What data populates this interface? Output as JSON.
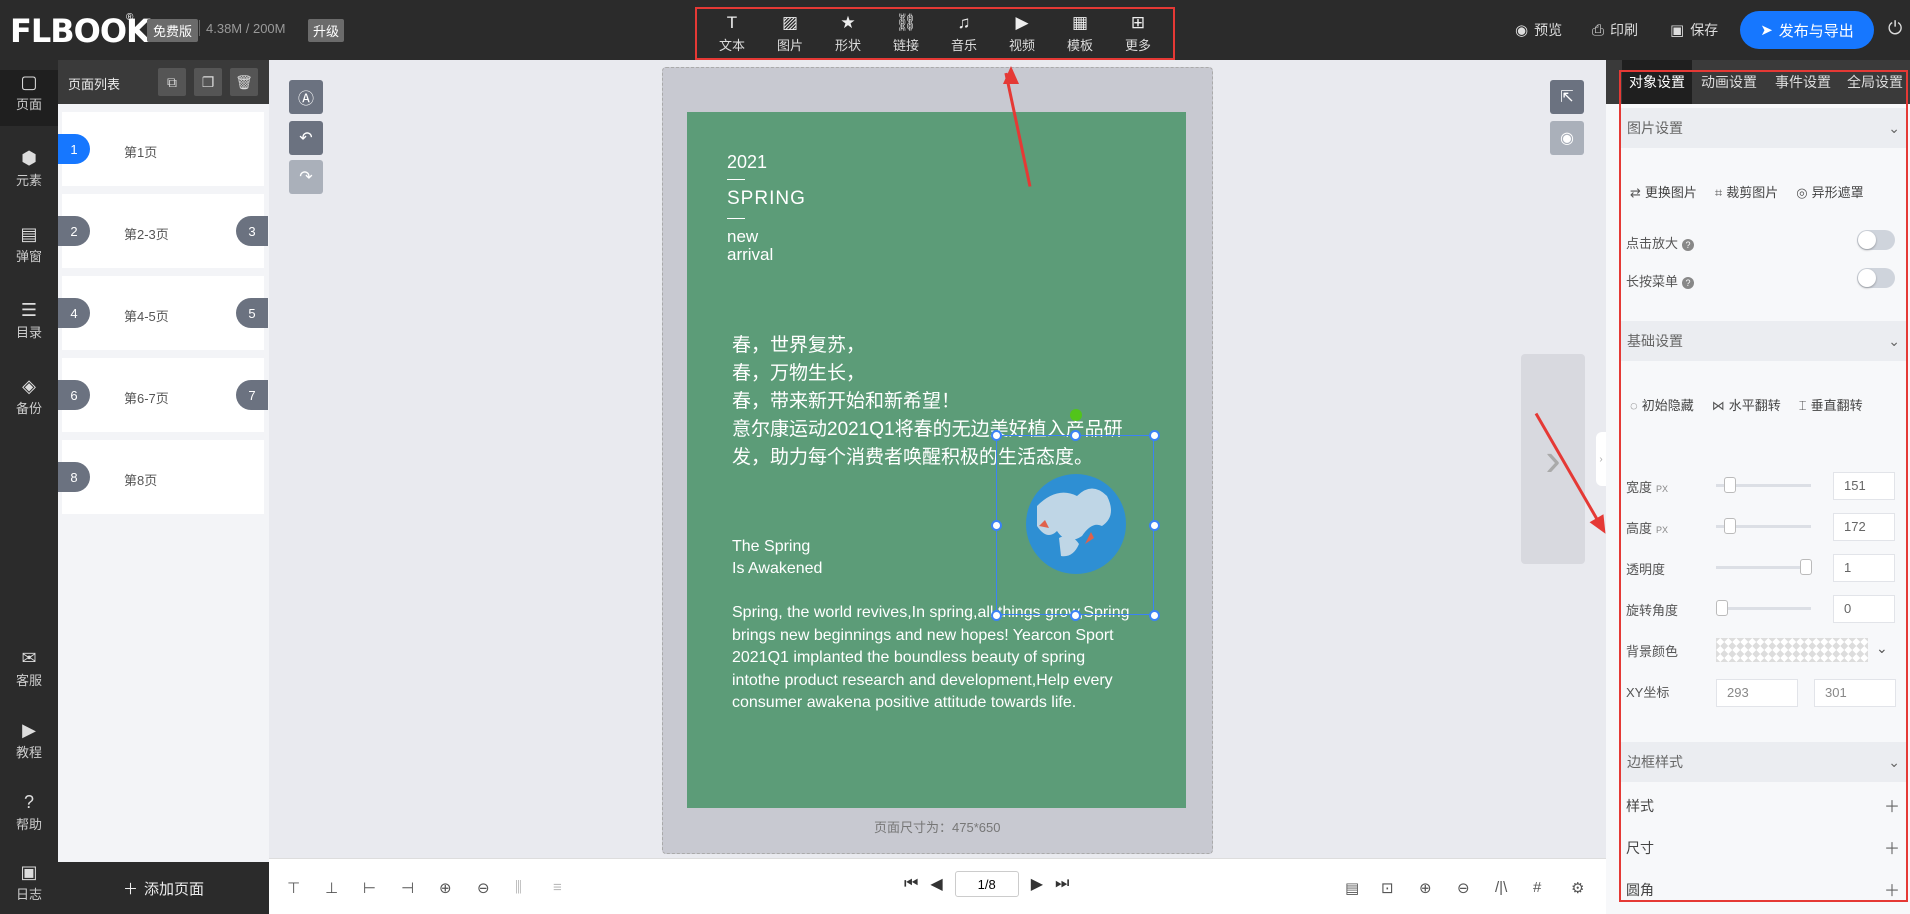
{
  "app": {
    "logo": "FLBOOK",
    "plan_badge": "免费版",
    "storage": "4.38M / 200M",
    "upgrade": "升级"
  },
  "toolbar": {
    "tools": [
      {
        "label": "文本",
        "icon": "T"
      },
      {
        "label": "图片",
        "icon": "▨"
      },
      {
        "label": "形状",
        "icon": "★"
      },
      {
        "label": "链接",
        "icon": "⛓"
      },
      {
        "label": "音乐",
        "icon": "♫"
      },
      {
        "label": "视频",
        "icon": "▶"
      },
      {
        "label": "模板",
        "icon": "▦"
      },
      {
        "label": "更多",
        "icon": "⊞"
      }
    ]
  },
  "top_actions": {
    "preview": "预览",
    "print": "印刷",
    "save": "保存",
    "publish": "发布与导出"
  },
  "left_nav": [
    {
      "label": "页面",
      "icon": "▢"
    },
    {
      "label": "元素",
      "icon": "⬢"
    },
    {
      "label": "弹窗",
      "icon": "▤"
    },
    {
      "label": "目录",
      "icon": "☰"
    },
    {
      "label": "备份",
      "icon": "◈"
    },
    {
      "label": "客服",
      "icon": "✉"
    },
    {
      "label": "教程",
      "icon": "▶"
    },
    {
      "label": "帮助",
      "icon": "?"
    },
    {
      "label": "日志",
      "icon": "▣"
    }
  ],
  "page_list": {
    "title": "页面列表",
    "pages": [
      {
        "left": "1",
        "right": "",
        "label": "第1页"
      },
      {
        "left": "2",
        "right": "3",
        "label": "第2-3页"
      },
      {
        "left": "4",
        "right": "5",
        "label": "第4-5页"
      },
      {
        "left": "6",
        "right": "7",
        "label": "第6-7页"
      },
      {
        "left": "8",
        "right": "",
        "label": "第8页"
      }
    ],
    "add_page": "添加页面"
  },
  "canvas": {
    "page_size": "页面尺寸为：475*650",
    "year": "2021",
    "spring": "SPRING",
    "new_arrival": "new\narrival",
    "cn_text": "春，世界复苏，\n春，万物生长，\n春，带来新开始和新希望！\n意尔康运动2021Q1将春的无边美好植入产品研发，助力每个消费者唤醒积极的生活态度。",
    "en_title": "The Spring\nIs Awakened",
    "en_body": "Spring, the world revives,In spring,all things grow,Spring brings new beginnings and new hopes! Yearcon Sport 2021Q1 implanted the boundless beauty of spring intothe product research and development,Help every consumer awakena positive attitude towards life."
  },
  "pager": {
    "current": "1/8"
  },
  "right_panel": {
    "tabs": [
      "对象设置",
      "动画设置",
      "事件设置",
      "全局设置"
    ],
    "image_settings": {
      "title": "图片设置",
      "actions": [
        "更换图片",
        "裁剪图片",
        "异形遮罩"
      ],
      "click_zoom": "点击放大",
      "long_press": "长按菜单"
    },
    "basic_settings": {
      "title": "基础设置",
      "actions": [
        "初始隐藏",
        "水平翻转",
        "垂直翻转"
      ],
      "width_label": "宽度",
      "height_label": "高度",
      "unit": "PX",
      "opacity_label": "透明度",
      "rotation_label": "旋转角度",
      "bg_label": "背景颜色",
      "xy_label": "XY坐标",
      "width": "151",
      "height": "172",
      "opacity": "1",
      "rotation": "0",
      "x": "293",
      "y": "301"
    },
    "border": {
      "title": "边框样式",
      "style": "样式",
      "size": "尺寸",
      "radius": "圆角"
    }
  }
}
